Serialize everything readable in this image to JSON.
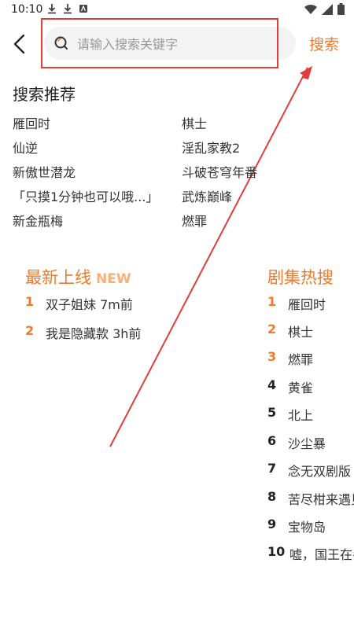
{
  "status_bar": {
    "time": "10:10"
  },
  "header": {
    "search_placeholder": "请输入搜索关键字",
    "search_button": "搜索"
  },
  "recommend": {
    "title": "搜索推荐",
    "items": [
      "雁回时",
      "棋士",
      "仙逆",
      "淫乱家教2",
      "新傲世潜龙",
      "斗破苍穹年番",
      "「只摸1分钟也可以哦...」",
      "武炼巅峰",
      "新金瓶梅",
      "燃罪"
    ]
  },
  "latest": {
    "title": "最新上线",
    "badge": "NEW",
    "items": [
      {
        "rank": "1",
        "text": "双子姐妹 7m前"
      },
      {
        "rank": "2",
        "text": "我是隐藏款 3h前"
      }
    ]
  },
  "hot": {
    "title": "剧集热搜",
    "items": [
      {
        "rank": "1",
        "text": "雁回时"
      },
      {
        "rank": "2",
        "text": "棋士"
      },
      {
        "rank": "3",
        "text": "燃罪"
      },
      {
        "rank": "4",
        "text": "黄雀"
      },
      {
        "rank": "5",
        "text": "北上"
      },
      {
        "rank": "6",
        "text": "沙尘暴"
      },
      {
        "rank": "7",
        "text": "念无双剧版"
      },
      {
        "rank": "8",
        "text": "苦尽柑来遇见你"
      },
      {
        "rank": "9",
        "text": "宝物岛"
      },
      {
        "rank": "10",
        "text": "嘘，国王在冬眠"
      }
    ]
  },
  "colors": {
    "accent": "#f07a2a",
    "highlight": "#e23d3d"
  }
}
